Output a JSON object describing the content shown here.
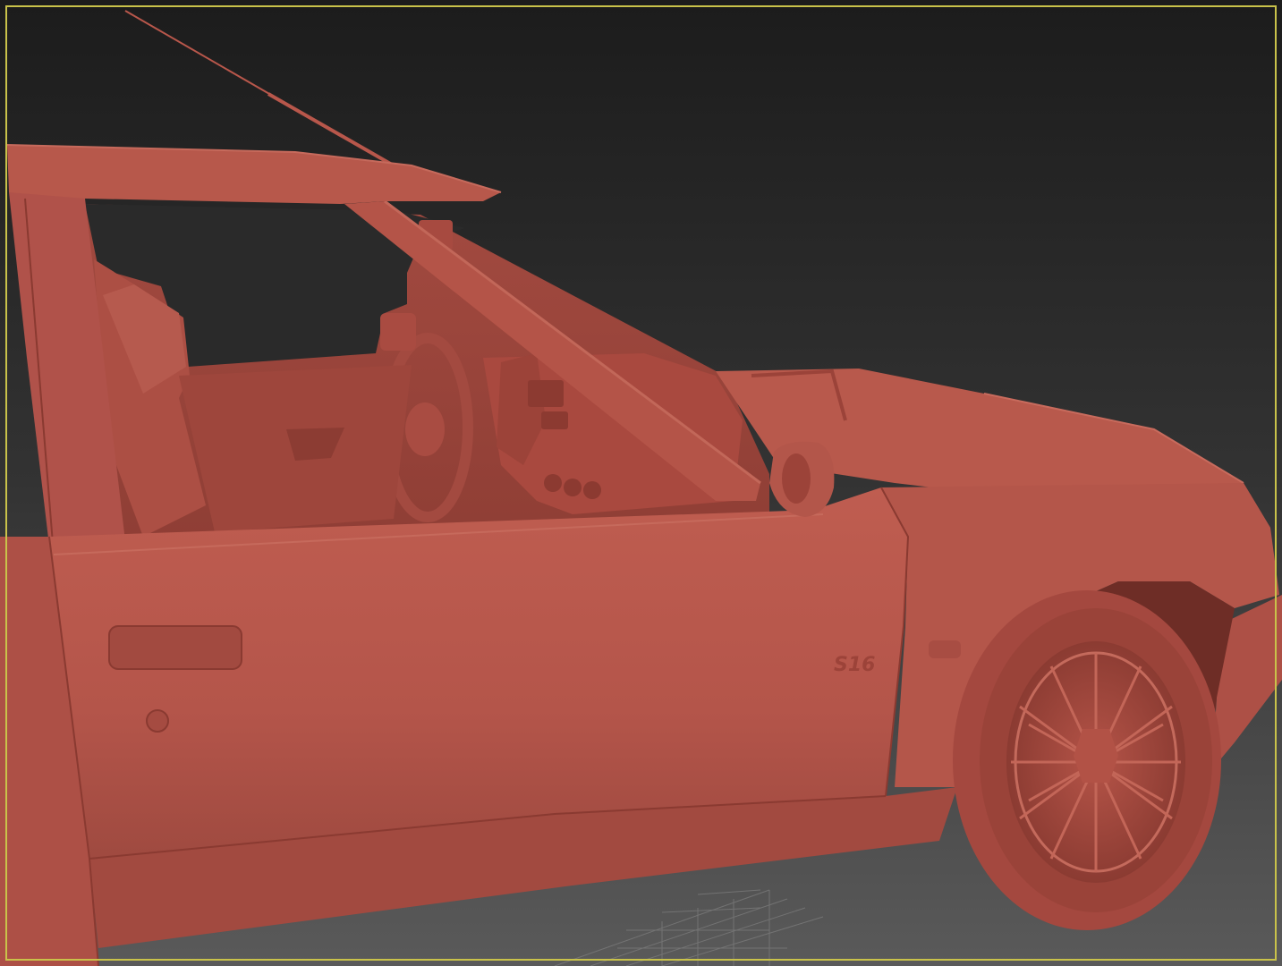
{
  "viewport": {
    "border_color": "#c9c24a",
    "background_top": "#1c1c1c",
    "background_bottom": "#5a5a5a",
    "grid_color": "#7a7a7a"
  },
  "model": {
    "body_color": "#b8574b",
    "shadow_color": "#8a3a31",
    "highlight_color": "#c96a5c",
    "badge": "S16"
  }
}
